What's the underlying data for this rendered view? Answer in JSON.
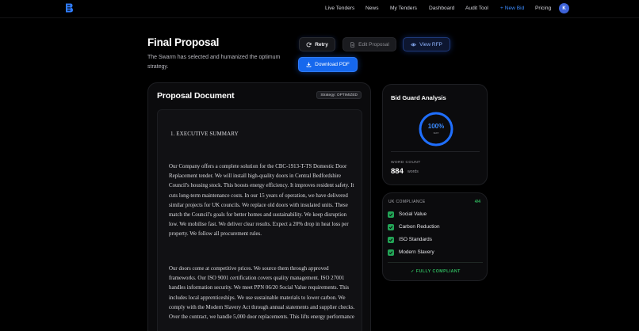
{
  "nav": {
    "logo_icon": "bee-logo-icon",
    "links": [
      "Live Tenders",
      "News",
      "My Tenders",
      "Dashboard",
      "Audit Tool",
      "+ New Bid",
      "Pricing"
    ],
    "avatar_initial": "K",
    "accent_color": "#3b8bff"
  },
  "header": {
    "title": "Final Proposal",
    "subtitle": "The Swarm has selected and humanized the optimum strategy.",
    "retry_label": "Retry",
    "edit_label": "Edit Proposal",
    "view_label": "View RFP",
    "download_label": "Download PDF"
  },
  "proposal": {
    "title": "Proposal Document",
    "strategy_badge": "Strategy: OPTIMIZED",
    "heading": "1.  EXECUTIVE SUMMARY",
    "paragraphs": [
      "Our Company offers a complete solution for the CBC-1913-T-TS Domestic Door Replacement tender. We will install high-quality doors in Central Bedfordshire Council's housing stock. This boosts energy efficiency. It improves resident safety. It cuts long-term maintenance costs. In our 15 years of operation, we have delivered similar projects for UK councils. We replace old doors with insulated units. These match the Council's goals for better homes and sustainability. We keep disruption low. We mobilise fast. We deliver clear results. Expect a 20% drop in heat loss per property. We follow all procurement rules.",
      "Our doors come at competitive prices. We source them through approved frameworks. Our ISO 9001 certification covers quality management. ISO 27001 handles information security. We meet PPN 06/20 Social Value requirements. This includes local apprenticeships. We use sustainable materials to lower carbon. We comply with the Modern Slavery Act through annual statements and supplier checks. Over the contract, we handle 5,000 door replacements. This lifts energy performance"
    ]
  },
  "bid_guard": {
    "title": "Bid Guard Analysis",
    "score_percent": 100,
    "score_label": "100%",
    "score_caption": "sure",
    "word_count_label": "WORD COUNT",
    "word_count_value": "884",
    "word_count_unit": "words"
  },
  "compliance": {
    "title": "UK COMPLIANCE",
    "count": "4/4",
    "items": [
      "Social Value",
      "Carbon Reduction",
      "ISO Standards",
      "Modern Slavery"
    ],
    "status": "✓ FULLY COMPLIANT",
    "status_color": "#2fb85e"
  }
}
